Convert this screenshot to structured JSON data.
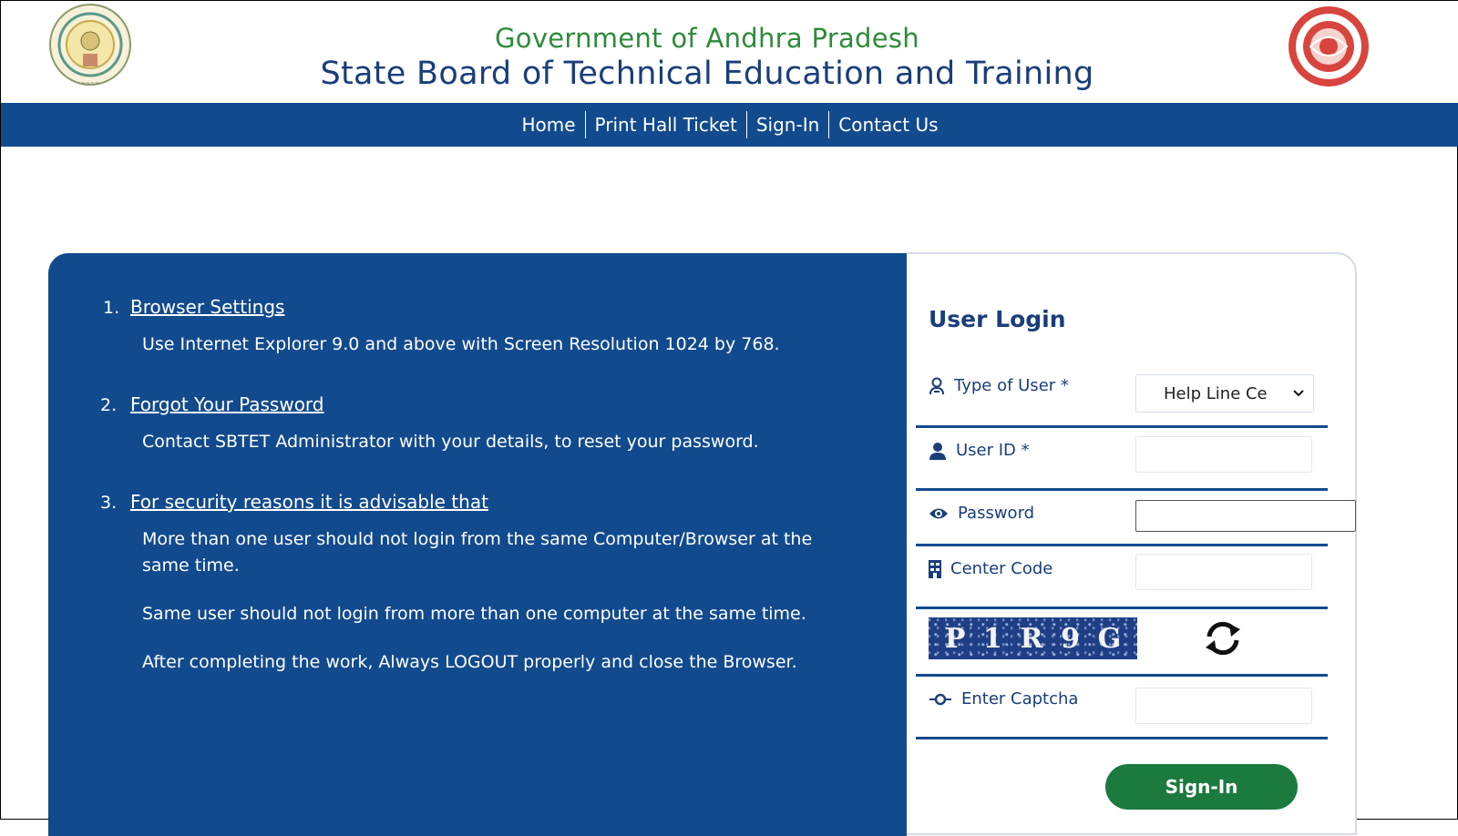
{
  "header": {
    "gov_title": "Government of Andhra Pradesh",
    "board_title": "State Board of Technical Education and Training"
  },
  "nav": {
    "items": [
      {
        "label": "Home"
      },
      {
        "label": "Print Hall Ticket"
      },
      {
        "label": "Sign-In"
      },
      {
        "label": "Contact Us"
      }
    ]
  },
  "info": {
    "items": [
      {
        "num": "1.",
        "heading": "Browser Settings",
        "texts": [
          "Use Internet Explorer 9.0 and above with Screen Resolution 1024 by 768."
        ]
      },
      {
        "num": "2.",
        "heading": "Forgot Your Password",
        "texts": [
          "Contact SBTET Administrator with your details, to reset your password."
        ]
      },
      {
        "num": "3.",
        "heading": "For security reasons it is advisable that",
        "texts": [
          "More than one user should not login from the same Computer/Browser at the same time.",
          "Same user should not login from more than one computer at the same time.",
          "After completing the work, Always LOGOUT properly and close the Browser."
        ]
      }
    ]
  },
  "login": {
    "title": "User Login",
    "type_of_user_label": "Type of User *",
    "type_of_user_value": "Help Line Ce",
    "user_id_label": "User ID *",
    "user_id_value": "",
    "password_label": "Password",
    "password_value": "",
    "center_code_label": "Center Code",
    "center_code_value": "",
    "captcha_chars": [
      "P",
      "1",
      "R",
      "9",
      "G"
    ],
    "enter_captcha_label": "Enter Captcha",
    "enter_captcha_value": "",
    "signin_label": "Sign-In"
  },
  "colors": {
    "navy": "#124a8e",
    "gov_green": "#2e8b3a",
    "button_green": "#1c7a3e"
  }
}
